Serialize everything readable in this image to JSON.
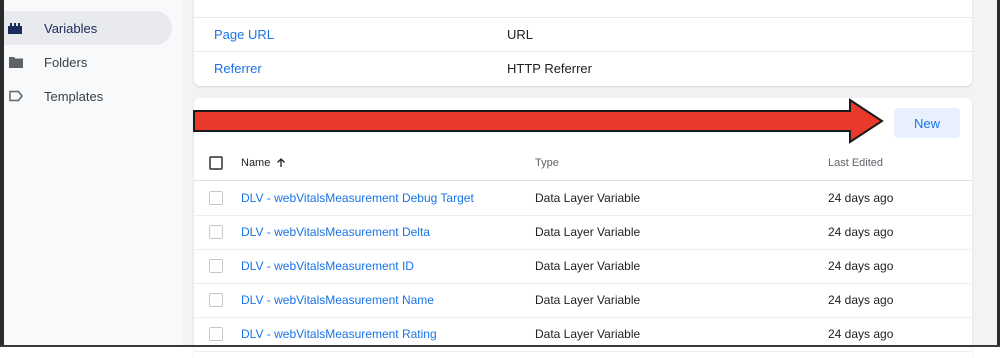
{
  "sidebar": {
    "items": [
      {
        "label": "Variables",
        "icon": "blocks-icon",
        "active": true
      },
      {
        "label": "Folders",
        "icon": "folder-icon",
        "active": false
      },
      {
        "label": "Templates",
        "icon": "label-tag-icon",
        "active": false
      }
    ]
  },
  "builtin_variables": {
    "rows": [
      {
        "name": "Page URL",
        "type": "URL"
      },
      {
        "name": "Referrer",
        "type": "HTTP Referrer"
      }
    ]
  },
  "user_variables": {
    "new_label": "New",
    "columns": {
      "name": "Name",
      "type": "Type",
      "last_edited": "Last Edited"
    },
    "rows": [
      {
        "name": "DLV - webVitalsMeasurement Debug Target",
        "type": "Data Layer Variable",
        "last_edited": "24 days ago"
      },
      {
        "name": "DLV - webVitalsMeasurement Delta",
        "type": "Data Layer Variable",
        "last_edited": "24 days ago"
      },
      {
        "name": "DLV - webVitalsMeasurement ID",
        "type": "Data Layer Variable",
        "last_edited": "24 days ago"
      },
      {
        "name": "DLV - webVitalsMeasurement Name",
        "type": "Data Layer Variable",
        "last_edited": "24 days ago"
      },
      {
        "name": "DLV - webVitalsMeasurement Rating",
        "type": "Data Layer Variable",
        "last_edited": "24 days ago"
      }
    ]
  },
  "annotation": {
    "color": "#e8392b"
  },
  "colors": {
    "link": "#1a73e8",
    "active_bg": "#e8eaed",
    "button_bg": "#e8f0fe"
  }
}
